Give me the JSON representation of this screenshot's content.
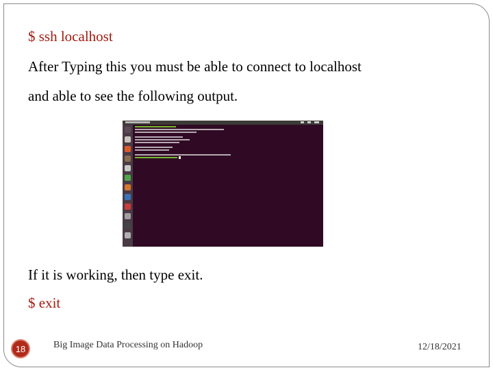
{
  "slide": {
    "command_ssh": "$ ssh localhost",
    "line_after_typing": "After Typing this you must be able to connect to localhost",
    "line_able_to_see": "and able to see the following output.",
    "line_if_working": "If it is working, then type exit.",
    "command_exit": "$ exit"
  },
  "footer": {
    "slide_number": "18",
    "title": "Big Image Data Processing on Hadoop",
    "date": "12/18/2021"
  },
  "colors": {
    "command_text": "#a31c10",
    "badge": "#b02a1a",
    "terminal_bg": "#300a24"
  },
  "icons": [
    "terminal-screenshot"
  ]
}
